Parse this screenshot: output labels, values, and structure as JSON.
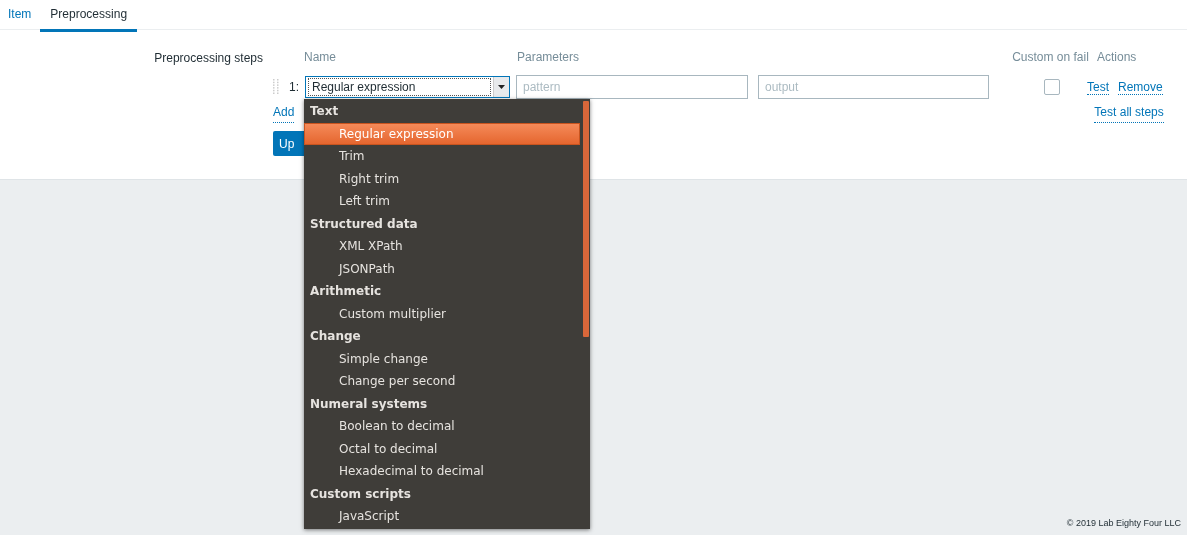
{
  "tabs": [
    {
      "label": "Item",
      "selected": false
    },
    {
      "label": "Preprocessing",
      "selected": true
    }
  ],
  "form": {
    "label": "Preprocessing steps",
    "columns": [
      "Name",
      "Parameters",
      "Custom on fail",
      "Actions"
    ],
    "steps": [
      {
        "number": "1:",
        "name": "Regular expression",
        "params": [
          {
            "placeholder": "pattern"
          },
          {
            "placeholder": "output"
          }
        ],
        "custom_on_fail": false,
        "actions": [
          "Test",
          "Remove"
        ]
      }
    ],
    "add_link": "Add",
    "test_all_link": "Test all steps",
    "update_button": "Up"
  },
  "dropdown": {
    "groups": [
      {
        "label": "Text",
        "items": [
          {
            "label": "Regular expression",
            "selected": true
          },
          {
            "label": "Trim",
            "selected": false
          },
          {
            "label": "Right trim",
            "selected": false
          },
          {
            "label": "Left trim",
            "selected": false
          }
        ]
      },
      {
        "label": "Structured data",
        "items": [
          {
            "label": "XML XPath",
            "selected": false
          },
          {
            "label": "JSONPath",
            "selected": false
          }
        ]
      },
      {
        "label": "Arithmetic",
        "items": [
          {
            "label": "Custom multiplier",
            "selected": false
          }
        ]
      },
      {
        "label": "Change",
        "items": [
          {
            "label": "Simple change",
            "selected": false
          },
          {
            "label": "Change per second",
            "selected": false
          }
        ]
      },
      {
        "label": "Numeral systems",
        "items": [
          {
            "label": "Boolean to decimal",
            "selected": false
          },
          {
            "label": "Octal to decimal",
            "selected": false
          },
          {
            "label": "Hexadecimal to decimal",
            "selected": false
          }
        ]
      },
      {
        "label": "Custom scripts",
        "items": [
          {
            "label": "JavaScript",
            "selected": false
          }
        ]
      }
    ]
  },
  "footer": "© 2019 Lab Eighty Four LLC"
}
